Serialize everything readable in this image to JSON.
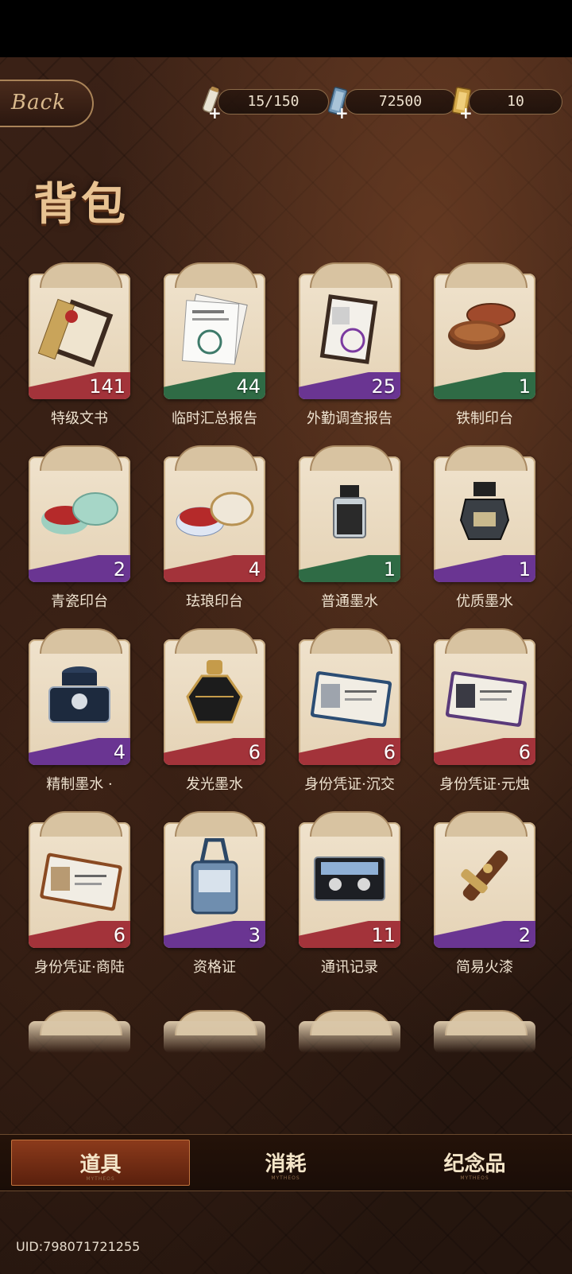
{
  "top_bar": {
    "back_label": "Back",
    "resources": [
      {
        "icon": "scroll-icon",
        "value": "15/150"
      },
      {
        "icon": "ticket-icon",
        "value": "72500"
      },
      {
        "icon": "gold-card-icon",
        "value": "10"
      }
    ]
  },
  "page_title": "背包",
  "items": [
    {
      "name": "特级文书",
      "count": "141",
      "rarity_color": "#a3333a",
      "icon": "scroll-box-icon"
    },
    {
      "name": "临时汇总报告",
      "count": "44",
      "rarity_color": "#2f6b45",
      "icon": "report-papers-icon"
    },
    {
      "name": "外勤调查报告",
      "count": "25",
      "rarity_color": "#6a3592",
      "icon": "investigation-report-icon"
    },
    {
      "name": "铁制印台",
      "count": "1",
      "rarity_color": "#2f6b45",
      "icon": "iron-ink-pad-icon"
    },
    {
      "name": "青瓷印台",
      "count": "2",
      "rarity_color": "#6a3592",
      "icon": "celadon-ink-pad-icon"
    },
    {
      "name": "珐琅印台",
      "count": "4",
      "rarity_color": "#a3333a",
      "icon": "enamel-ink-pad-icon"
    },
    {
      "name": "普通墨水",
      "count": "1",
      "rarity_color": "#2f6b45",
      "icon": "ink-bottle-icon"
    },
    {
      "name": "优质墨水",
      "count": "1",
      "rarity_color": "#6a3592",
      "icon": "quality-ink-bottle-icon"
    },
    {
      "name": "精制墨水 ·",
      "count": "4",
      "rarity_color": "#6a3592",
      "icon": "refined-ink-bottle-icon"
    },
    {
      "name": "发光墨水",
      "count": "6",
      "rarity_color": "#a3333a",
      "icon": "glowing-ink-bottle-icon"
    },
    {
      "name": "身份凭证·沉交",
      "count": "6",
      "rarity_color": "#a3333a",
      "icon": "id-card-icon"
    },
    {
      "name": "身份凭证·元烛",
      "count": "6",
      "rarity_color": "#a3333a",
      "icon": "id-card-icon"
    },
    {
      "name": "身份凭证·商陆",
      "count": "6",
      "rarity_color": "#a3333a",
      "icon": "id-card-icon"
    },
    {
      "name": "资格证",
      "count": "3",
      "rarity_color": "#6a3592",
      "icon": "badge-lanyard-icon"
    },
    {
      "name": "通讯记录",
      "count": "11",
      "rarity_color": "#a3333a",
      "icon": "cassette-tape-icon"
    },
    {
      "name": "简易火漆",
      "count": "2",
      "rarity_color": "#6a3592",
      "icon": "wax-seal-stick-icon"
    }
  ],
  "tabs": [
    {
      "label": "道具",
      "sub": "MYTHEOS",
      "active": true
    },
    {
      "label": "消耗",
      "sub": "MYTHEOS",
      "active": false
    },
    {
      "label": "纪念品",
      "sub": "MYTHEOS",
      "active": false
    }
  ],
  "uid": "UID:798071721255"
}
